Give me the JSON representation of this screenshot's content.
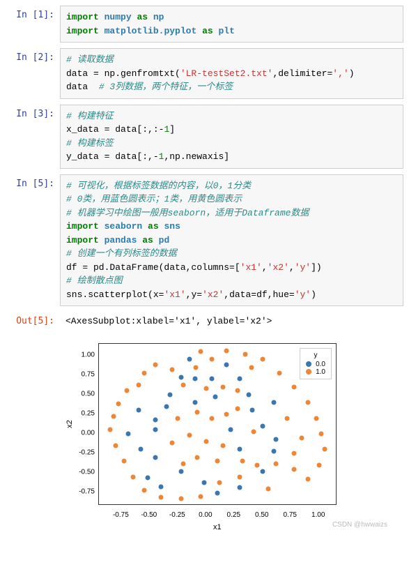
{
  "cells": {
    "c1": {
      "prompt": "In  [1]:"
    },
    "c2": {
      "prompt": "In  [2]:"
    },
    "c3": {
      "prompt": "In  [3]:"
    },
    "c5": {
      "prompt": "In  [5]:"
    },
    "out5": {
      "prompt": "Out[5]:"
    }
  },
  "code": {
    "c1": {
      "l1_kw1": "import",
      "l1_nn1": "numpy",
      "l1_kw2": "as",
      "l1_nn2": "np",
      "l2_kw1": "import",
      "l2_nn1": "matplotlib.pyplot",
      "l2_kw2": "as",
      "l2_nn2": "plt"
    },
    "c2": {
      "l1_cmt": "# 读取数据",
      "l2_a": "data = np.genfromtxt(",
      "l2_str1": "'LR-testSet2.txt'",
      "l2_b": ",delimiter=",
      "l2_str2": "','",
      "l2_c": ")",
      "l3_a": "data  ",
      "l3_cmt": "# 3列数据，两个特征，一个标签"
    },
    "c3": {
      "l1_cmt": "# 构建特征",
      "l2": "x_data = data[:,:-",
      "l2_num": "1",
      "l2b": "]",
      "l3_cmt": "# 构建标签",
      "l4": "y_data = data[:,-",
      "l4_num": "1",
      "l4b": ",np.newaxis]"
    },
    "c5": {
      "l1_cmt": "# 可视化，根据标签数据的内容，以0，1分类",
      "l2_cmt": "# 0类，用蓝色圆表示；1类，用黄色圆表示",
      "l3_cmt": "# 机器学习中绘图一般用seaborn，适用于Dataframe数据",
      "l4_kw1": "import",
      "l4_nn1": "seaborn",
      "l4_kw2": "as",
      "l4_nn2": "sns",
      "l5_kw1": "import",
      "l5_nn1": "pandas",
      "l5_kw2": "as",
      "l5_nn2": "pd",
      "l6_cmt": "# 创建一个有列标签的数据",
      "l7_a": "df = pd.DataFrame(data,columns=[",
      "l7_s1": "'x1'",
      "l7_b": ",",
      "l7_s2": "'x2'",
      "l7_c": ",",
      "l7_s3": "'y'",
      "l7_d": "])",
      "l8_cmt": "# 绘制散点图",
      "l9_a": "sns.scatterplot(x=",
      "l9_s1": "'x1'",
      "l9_b": ",y=",
      "l9_s2": "'x2'",
      "l9_c": ",data=df,hue=",
      "l9_s3": "'y'",
      "l9_d": ")"
    }
  },
  "output": {
    "out5": "<AxesSubplot:xlabel='x1', ylabel='x2'>"
  },
  "chart_data": {
    "type": "scatter",
    "xlabel": "x1",
    "ylabel": "x2",
    "legend_title": "y",
    "legend_items": [
      {
        "label": "0.0",
        "color": "#3a76af"
      },
      {
        "label": "1.0",
        "color": "#ef8636"
      }
    ],
    "xlim": [
      -0.95,
      1.15
    ],
    "ylim": [
      -0.9,
      1.15
    ],
    "xticks": [
      "-0.75",
      "-0.50",
      "-0.25",
      "0.00",
      "0.25",
      "0.50",
      "0.75",
      "1.00"
    ],
    "yticks": [
      "-0.75",
      "-0.50",
      "-0.25",
      "0.00",
      "0.25",
      "0.50",
      "0.75",
      "1.00"
    ],
    "points": [
      {
        "x": 0.05,
        "y": 0.7,
        "c": 0
      },
      {
        "x": -0.1,
        "y": 0.7,
        "c": 0
      },
      {
        "x": -0.22,
        "y": 0.72,
        "c": 0
      },
      {
        "x": 0.38,
        "y": 0.5,
        "c": 0
      },
      {
        "x": 0.08,
        "y": 0.47,
        "c": 0
      },
      {
        "x": -0.35,
        "y": 0.35,
        "c": 0
      },
      {
        "x": 0.41,
        "y": 0.3,
        "c": 0
      },
      {
        "x": 0.22,
        "y": 0.05,
        "c": 0
      },
      {
        "x": -0.45,
        "y": 0.05,
        "c": 0
      },
      {
        "x": -0.45,
        "y": 0.18,
        "c": 0
      },
      {
        "x": 0.3,
        "y": -0.2,
        "c": 0
      },
      {
        "x": 0.6,
        "y": -0.22,
        "c": 0
      },
      {
        "x": -0.22,
        "y": -0.48,
        "c": 0
      },
      {
        "x": 0.5,
        "y": -0.48,
        "c": 0
      },
      {
        "x": -0.45,
        "y": -0.3,
        "c": 0
      },
      {
        "x": -0.52,
        "y": -0.56,
        "c": 0
      },
      {
        "x": -0.4,
        "y": -0.68,
        "c": 0
      },
      {
        "x": 0.1,
        "y": -0.76,
        "c": 0
      },
      {
        "x": -0.02,
        "y": -0.62,
        "c": 0
      },
      {
        "x": 0.3,
        "y": -0.69,
        "c": 0
      },
      {
        "x": 0.3,
        "y": 0.7,
        "c": 0
      },
      {
        "x": 0.6,
        "y": 0.4,
        "c": 0
      },
      {
        "x": 0.62,
        "y": -0.07,
        "c": 0
      },
      {
        "x": -0.69,
        "y": 0.0,
        "c": 0
      },
      {
        "x": -0.6,
        "y": 0.3,
        "c": 0
      },
      {
        "x": -0.15,
        "y": 0.95,
        "c": 0
      },
      {
        "x": -0.58,
        "y": -0.2,
        "c": 0
      },
      {
        "x": 0.18,
        "y": 0.88,
        "c": 0
      },
      {
        "x": -0.32,
        "y": 0.5,
        "c": 0
      },
      {
        "x": 0.5,
        "y": 0.1,
        "c": 0
      },
      {
        "x": -0.1,
        "y": 0.4,
        "c": 0
      },
      {
        "x": -0.09,
        "y": 0.85,
        "c": 1
      },
      {
        "x": 0.05,
        "y": 0.95,
        "c": 1
      },
      {
        "x": 0.18,
        "y": 1.06,
        "c": 1
      },
      {
        "x": 0.4,
        "y": 0.85,
        "c": 1
      },
      {
        "x": -0.3,
        "y": 0.82,
        "c": 1
      },
      {
        "x": -0.45,
        "y": 0.88,
        "c": 1
      },
      {
        "x": -0.55,
        "y": 0.78,
        "c": 1
      },
      {
        "x": -0.7,
        "y": 0.55,
        "c": 1
      },
      {
        "x": -0.78,
        "y": 0.38,
        "c": 1
      },
      {
        "x": -0.82,
        "y": 0.22,
        "c": 1
      },
      {
        "x": -0.85,
        "y": 0.05,
        "c": 1
      },
      {
        "x": -0.8,
        "y": -0.15,
        "c": 1
      },
      {
        "x": -0.73,
        "y": -0.35,
        "c": 1
      },
      {
        "x": -0.65,
        "y": -0.55,
        "c": 1
      },
      {
        "x": -0.55,
        "y": -0.72,
        "c": 1
      },
      {
        "x": -0.4,
        "y": -0.81,
        "c": 1
      },
      {
        "x": -0.22,
        "y": -0.83,
        "c": 1
      },
      {
        "x": -0.05,
        "y": -0.8,
        "c": 1
      },
      {
        "x": 0.12,
        "y": -0.62,
        "c": 1
      },
      {
        "x": 0.3,
        "y": -0.55,
        "c": 1
      },
      {
        "x": 0.45,
        "y": -0.4,
        "c": 1
      },
      {
        "x": 0.62,
        "y": -0.38,
        "c": 1
      },
      {
        "x": 0.78,
        "y": -0.45,
        "c": 1
      },
      {
        "x": 0.9,
        "y": -0.58,
        "c": 1
      },
      {
        "x": 1.0,
        "y": -0.4,
        "c": 1
      },
      {
        "x": 1.05,
        "y": -0.2,
        "c": 1
      },
      {
        "x": 1.02,
        "y": 0.0,
        "c": 1
      },
      {
        "x": 0.98,
        "y": 0.2,
        "c": 1
      },
      {
        "x": 0.9,
        "y": 0.4,
        "c": 1
      },
      {
        "x": 0.78,
        "y": 0.6,
        "c": 1
      },
      {
        "x": 0.65,
        "y": 0.78,
        "c": 1
      },
      {
        "x": 0.5,
        "y": 0.95,
        "c": 1
      },
      {
        "x": 0.35,
        "y": 1.02,
        "c": 1
      },
      {
        "x": -0.6,
        "y": 0.62,
        "c": 1
      },
      {
        "x": 0.85,
        "y": -0.05,
        "c": 1
      },
      {
        "x": 0.72,
        "y": 0.2,
        "c": 1
      },
      {
        "x": -0.05,
        "y": 1.05,
        "c": 1
      },
      {
        "x": 0.55,
        "y": -0.7,
        "c": 1
      },
      {
        "x": 0.78,
        "y": -0.25,
        "c": 1
      },
      {
        "x": -0.2,
        "y": 0.62,
        "c": 1
      },
      {
        "x": 0.0,
        "y": 0.58,
        "c": 1
      },
      {
        "x": 0.15,
        "y": 0.6,
        "c": 1
      },
      {
        "x": 0.28,
        "y": 0.55,
        "c": 1
      },
      {
        "x": -0.08,
        "y": 0.28,
        "c": 1
      },
      {
        "x": 0.05,
        "y": 0.2,
        "c": 1
      },
      {
        "x": 0.18,
        "y": 0.25,
        "c": 1
      },
      {
        "x": 0.28,
        "y": 0.32,
        "c": 1
      },
      {
        "x": -0.25,
        "y": 0.2,
        "c": 1
      },
      {
        "x": -0.15,
        "y": -0.02,
        "c": 1
      },
      {
        "x": 0.0,
        "y": -0.1,
        "c": 1
      },
      {
        "x": 0.15,
        "y": -0.15,
        "c": 1
      },
      {
        "x": -0.3,
        "y": -0.12,
        "c": 1
      },
      {
        "x": -0.08,
        "y": -0.3,
        "c": 1
      },
      {
        "x": 0.1,
        "y": -0.35,
        "c": 1
      },
      {
        "x": 0.32,
        "y": -0.35,
        "c": 1
      },
      {
        "x": -0.2,
        "y": -0.38,
        "c": 1
      },
      {
        "x": 0.42,
        "y": 0.03,
        "c": 1
      }
    ]
  },
  "watermark": "CSDN @hwwaizs"
}
